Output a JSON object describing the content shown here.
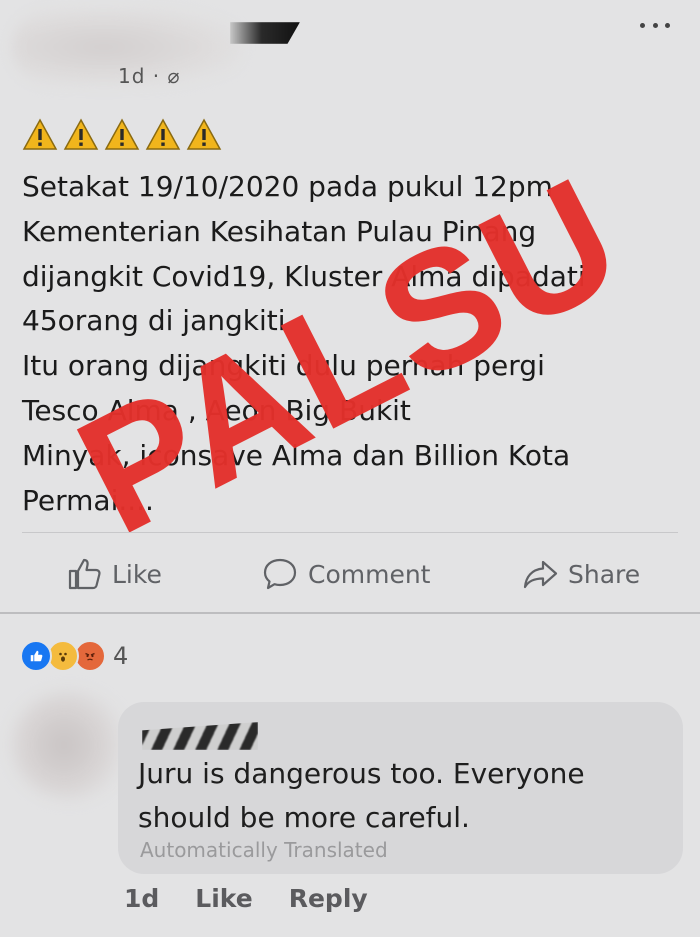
{
  "post": {
    "meta": "1d · ⌀",
    "warning_icon_count": 5,
    "body_text": "Setakat 19/10/2020 pada pukul 12pm\nKementerian Kesihatan Pulau Pinang\ndijangkit Covid19, Kluster Alma dipadati\n45orang di jangkiti\n Itu orang dijangkiti dulu pernah pergi\nTesco Alma , Aeon Big Bukit\nMinyak, iconsave Alma dan Billion Kota\nPermai....",
    "stamp_text": "PALSU",
    "stamp_color": "#e4302b"
  },
  "actions": {
    "like_label": "Like",
    "comment_label": "Comment",
    "share_label": "Share"
  },
  "reactions": {
    "count": "4"
  },
  "comment": {
    "text": "Juru is dangerous too. Everyone\nshould be more careful.",
    "translated_label": "Automatically Translated",
    "time": "1d",
    "like_label": "Like",
    "reply_label": "Reply"
  }
}
